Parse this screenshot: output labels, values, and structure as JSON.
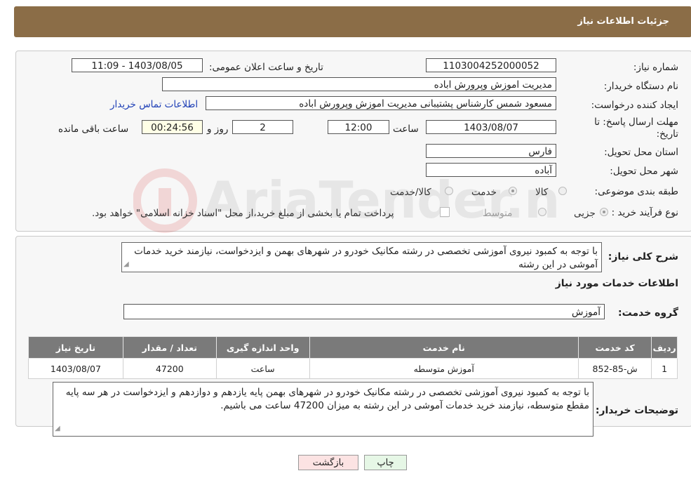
{
  "header": {
    "title": "جزئیات اطلاعات نیاز"
  },
  "watermark": {
    "text": "AriaTender.neT"
  },
  "form": {
    "need_number_label": "شماره نیاز:",
    "need_number": "1103004252000052",
    "announce_label": "تاریخ و ساعت اعلان عمومی:",
    "announce_value": "1403/08/05 - 11:09",
    "buyer_org_label": "نام دستگاه خریدار:",
    "buyer_org": "مدیریت اموزش وپرورش اباده",
    "creator_label": "ایجاد کننده درخواست:",
    "creator": "مسعود شمس کارشناس پشتیبانی مدیریت اموزش وپرورش اباده",
    "contact_link": "اطلاعات تماس خریدار",
    "deadline_label_1": "مهلت ارسال پاسخ: تا",
    "deadline_label_2": "تاریخ:",
    "deadline_date": "1403/08/07",
    "time_label": "ساعت",
    "deadline_time": "12:00",
    "days_value": "2",
    "days_label": "روز و",
    "remaining_value": "00:24:56",
    "remaining_label": "ساعت باقی مانده",
    "province_label": "استان محل تحویل:",
    "province": "فارس",
    "city_label": "شهر محل تحویل:",
    "city": "آباده",
    "category_label": "طبقه بندی موضوعی:",
    "category_options": [
      "کالا",
      "خدمت",
      "کالا/خدمت"
    ],
    "category_selected": "خدمت",
    "process_label": "نوع فرآیند خرید :",
    "process_options": [
      "جزیی",
      "متوسط"
    ],
    "process_selected": "جزیی",
    "payment_note": "پرداخت تمام یا بخشی از مبلغ خرید،از محل \"اسناد خزانه اسلامی\" خواهد بود."
  },
  "summary": {
    "label": "شرح کلی نیاز:",
    "text": "با توجه به کمبود نیروی آموزشی تخصصی در رشته مکانیک خودرو در شهرهای بهمن و ایزدخواست، نیازمند خرید خدمات آموشی در این رشته"
  },
  "services": {
    "section_title": "اطلاعات خدمات مورد نیاز",
    "group_label": "گروه خدمت:",
    "group_value": "آموزش",
    "columns": [
      "ردیف",
      "کد خدمت",
      "نام خدمت",
      "واحد اندازه گیری",
      "تعداد / مقدار",
      "تاریخ نیاز"
    ],
    "rows": [
      [
        "1",
        "ش-85-852",
        "آموزش متوسطه",
        "ساعت",
        "47200",
        "1403/08/07"
      ]
    ]
  },
  "buyer_notes": {
    "label": "توضیحات خریدار:",
    "text": "با توجه به کمبود نیروی آموزشی تخصصی در رشته مکانیک خودرو در شهرهای بهمن پایه یازدهم و دوازدهم و ایزدخواست در هر سه پایه مقطع متوسطه، نیازمند خرید خدمات آموشی در این رشته به میزان 47200 ساعت می باشیم."
  },
  "buttons": {
    "print": "چاپ",
    "back": "بازگشت"
  },
  "colors": {
    "header_bg": "#8b6d47",
    "table_header_bg": "#7a7a7a",
    "link": "#1e3fb6",
    "back_button_bg": "#fce3e3",
    "print_button_bg": "#e6f7e6"
  }
}
